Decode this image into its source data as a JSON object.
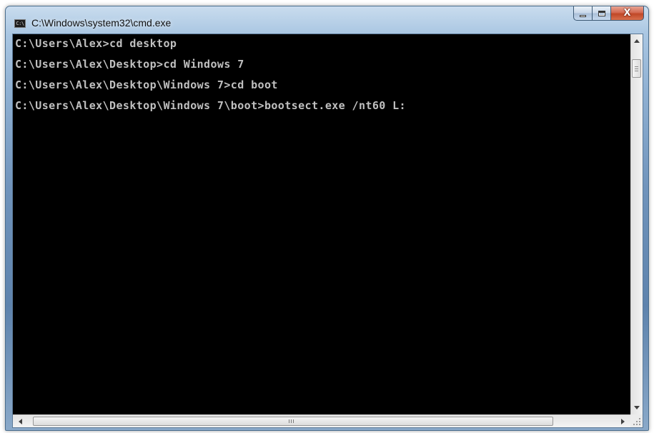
{
  "window": {
    "title": "C:\\Windows\\system32\\cmd.exe",
    "app_icon_text": "C:\\"
  },
  "caption_buttons": {
    "minimize": "minimize-icon",
    "maximize": "maximize-icon",
    "close_glyph": "X"
  },
  "console": {
    "lines": [
      "C:\\Users\\Alex>cd desktop",
      "C:\\Users\\Alex\\Desktop>cd Windows 7",
      "C:\\Users\\Alex\\Desktop\\Windows 7>cd boot",
      "C:\\Users\\Alex\\Desktop\\Windows 7\\boot>bootsect.exe /nt60 L:"
    ]
  },
  "colors": {
    "console_background": "#000000",
    "console_text": "#c0c0c0",
    "close_button": "#c8452a"
  },
  "icons": {
    "app": "cmd-icon",
    "scroll_up": "scroll-up-arrow-icon",
    "scroll_down": "scroll-down-arrow-icon",
    "scroll_left": "scroll-left-arrow-icon",
    "scroll_right": "scroll-right-arrow-icon",
    "resize": "resize-grip-icon"
  }
}
